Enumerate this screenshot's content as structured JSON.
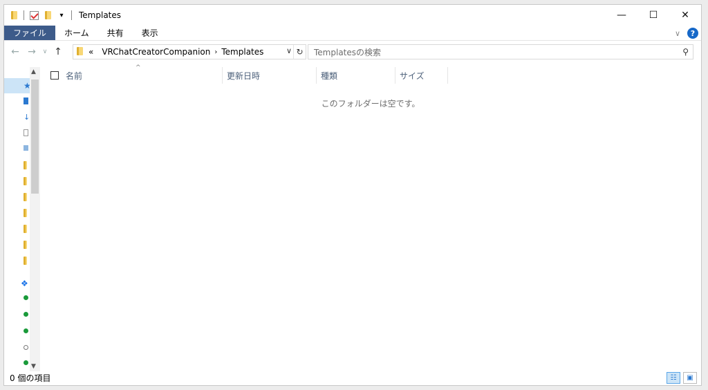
{
  "window": {
    "title": "Templates"
  },
  "ribbon": {
    "tabs": [
      "ファイル",
      "ホーム",
      "共有",
      "表示"
    ]
  },
  "address": {
    "overflow": "«",
    "crumbs": [
      "VRChatCreatorCompanion",
      "Templates"
    ]
  },
  "search": {
    "placeholder": "Templatesの検索"
  },
  "columns": [
    "名前",
    "更新日時",
    "種類",
    "サイズ"
  ],
  "content": {
    "empty_message": "このフォルダーは空です。"
  },
  "status": {
    "item_count": "0 個の項目"
  }
}
